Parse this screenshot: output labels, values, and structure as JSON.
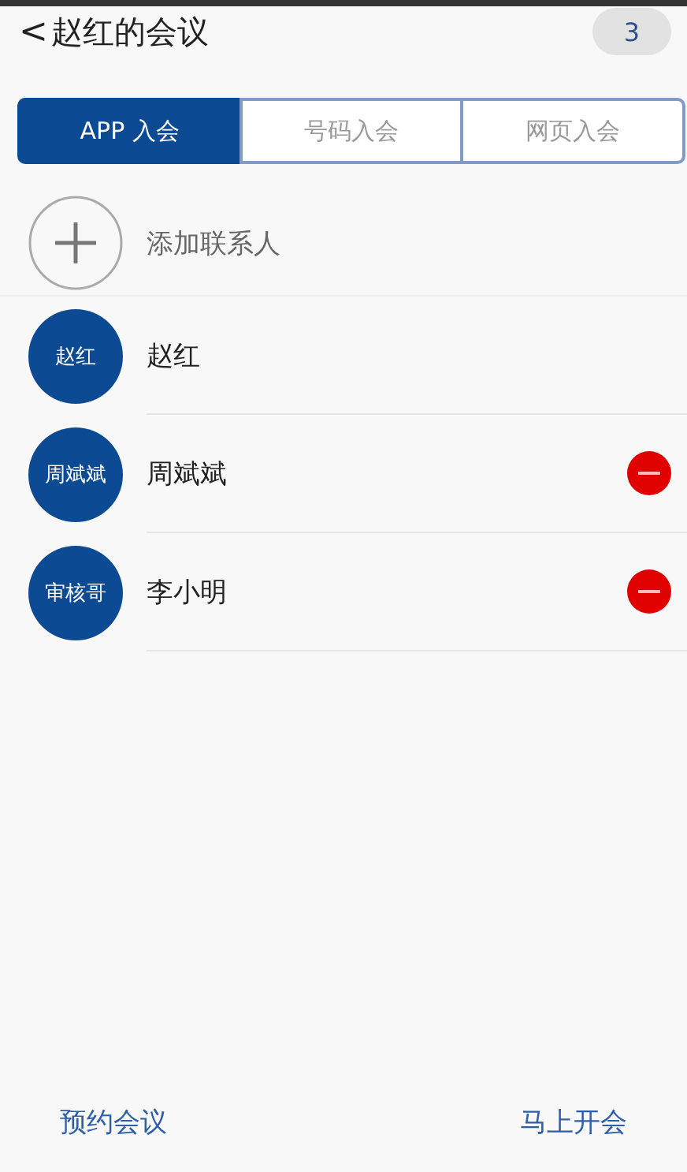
{
  "header": {
    "back_icon": "<",
    "title": "赵红的会议",
    "count": "3"
  },
  "tabs": [
    {
      "label": "APP 入会",
      "selected": true
    },
    {
      "label": "号码入会",
      "selected": false
    },
    {
      "label": "网页入会",
      "selected": false
    }
  ],
  "add_contact": {
    "label": "添加联系人"
  },
  "participants": [
    {
      "avatar": "赵红",
      "name": "赵红",
      "removable": false
    },
    {
      "avatar": "周斌斌",
      "name": "周斌斌",
      "removable": true
    },
    {
      "avatar": "审核哥",
      "name": "李小明",
      "removable": true
    }
  ],
  "footer": {
    "left": "预约会议",
    "right": "马上开会"
  }
}
